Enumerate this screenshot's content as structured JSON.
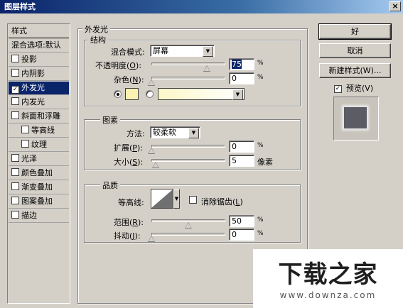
{
  "window": {
    "title": "图层样式",
    "close": "×"
  },
  "styles_list": {
    "header": "样式",
    "blend_item": "混合选项:默认",
    "items": [
      {
        "label": "投影",
        "checked": false,
        "indent": false
      },
      {
        "label": "内阴影",
        "checked": false,
        "indent": false
      },
      {
        "label": "外发光",
        "checked": true,
        "indent": false,
        "selected": true
      },
      {
        "label": "内发光",
        "checked": false,
        "indent": false
      },
      {
        "label": "斜面和浮雕",
        "checked": false,
        "indent": false
      },
      {
        "label": "等高线",
        "checked": false,
        "indent": true
      },
      {
        "label": "纹理",
        "checked": false,
        "indent": true
      },
      {
        "label": "光泽",
        "checked": false,
        "indent": false
      },
      {
        "label": "颜色叠加",
        "checked": false,
        "indent": false
      },
      {
        "label": "渐变叠加",
        "checked": false,
        "indent": false
      },
      {
        "label": "图案叠加",
        "checked": false,
        "indent": false
      },
      {
        "label": "描边",
        "checked": false,
        "indent": false
      }
    ]
  },
  "outer_glow": {
    "title": "外发光",
    "structure": {
      "title": "结构",
      "blend_mode_label": "混合模式:",
      "blend_mode_value": "屏幕",
      "opacity_label": "不透明度(",
      "opacity_key": "O",
      "opacity_value": "75",
      "opacity_pct": 0.75,
      "noise_label": "杂色(",
      "noise_key": "N",
      "noise_value": "0",
      "noise_pct": 0.0,
      "swatch_color": "#fbf1b0",
      "gradient_from": "#fdf7c8",
      "unit": "%"
    },
    "elements": {
      "title": "图素",
      "technique_label": "方法:",
      "technique_value": "较柔软",
      "spread_label": "扩展(",
      "spread_key": "P",
      "spread_value": "0",
      "size_label": "大小(",
      "size_key": "S",
      "size_value": "5",
      "size_unit": "像素",
      "unit": "%"
    },
    "quality": {
      "title": "品质",
      "contour_label": "等高线:",
      "antialias_label": "消除锯齿(",
      "antialias_key": "L",
      "range_label": "范围(",
      "range_key": "R",
      "range_value": "50",
      "range_pct": 0.5,
      "jitter_label": "抖动(",
      "jitter_key": "J",
      "jitter_value": "0",
      "unit": "%"
    }
  },
  "buttons": {
    "ok": "好",
    "cancel": "取消",
    "new_style": "新建样式(W)...",
    "preview": "预览(V)"
  },
  "watermark": {
    "logo": "下载之家",
    "url": "www.downza.com"
  }
}
